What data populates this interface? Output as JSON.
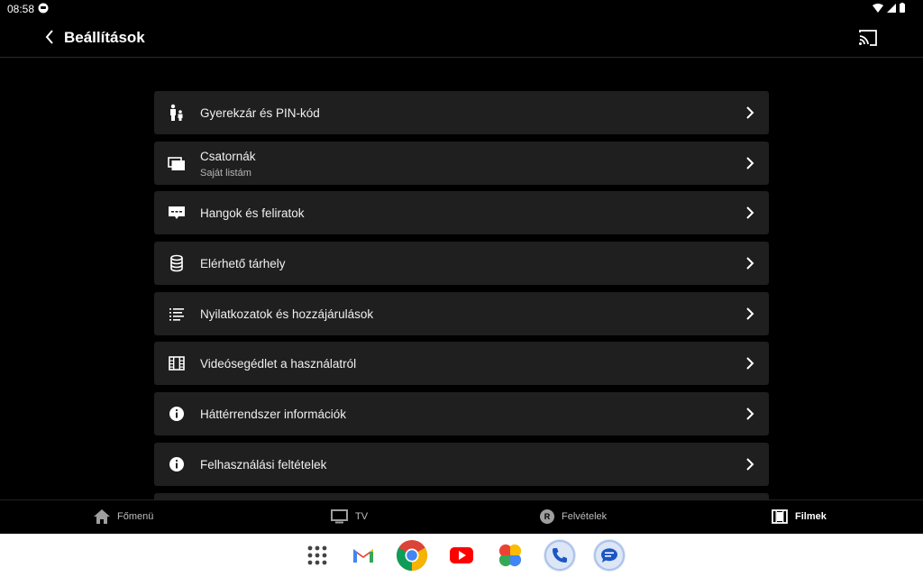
{
  "status": {
    "time": "08:58"
  },
  "appbar": {
    "title": "Beállítások"
  },
  "settings": [
    {
      "label": "Gyerekzár és PIN-kód",
      "icon": "parental-lock-icon"
    },
    {
      "label": "Csatornák",
      "sublabel": "Saját listám",
      "icon": "channels-icon"
    },
    {
      "label": "Hangok és feliratok",
      "icon": "subtitles-icon"
    },
    {
      "label": "Elérhető tárhely",
      "icon": "storage-icon"
    },
    {
      "label": "Nyilatkozatok és hozzájárulások",
      "icon": "list-icon"
    },
    {
      "label": "Videósegédlet a használatról",
      "icon": "film-icon"
    },
    {
      "label": "Háttérrendszer információk",
      "icon": "info-icon"
    },
    {
      "label": "Felhasználási feltételek",
      "icon": "info-icon"
    }
  ],
  "nav": [
    {
      "label": "Főmenü",
      "icon": "home-icon"
    },
    {
      "label": "TV",
      "icon": "tv-icon"
    },
    {
      "label": "Felvételek",
      "icon": "recordings-icon",
      "badge": "R"
    },
    {
      "label": "Filmek",
      "icon": "movies-icon",
      "active": true
    }
  ],
  "dock": [
    "app-drawer-icon",
    "gmail-icon",
    "chrome-icon",
    "youtube-icon",
    "photos-icon",
    "phone-icon",
    "messages-icon"
  ]
}
